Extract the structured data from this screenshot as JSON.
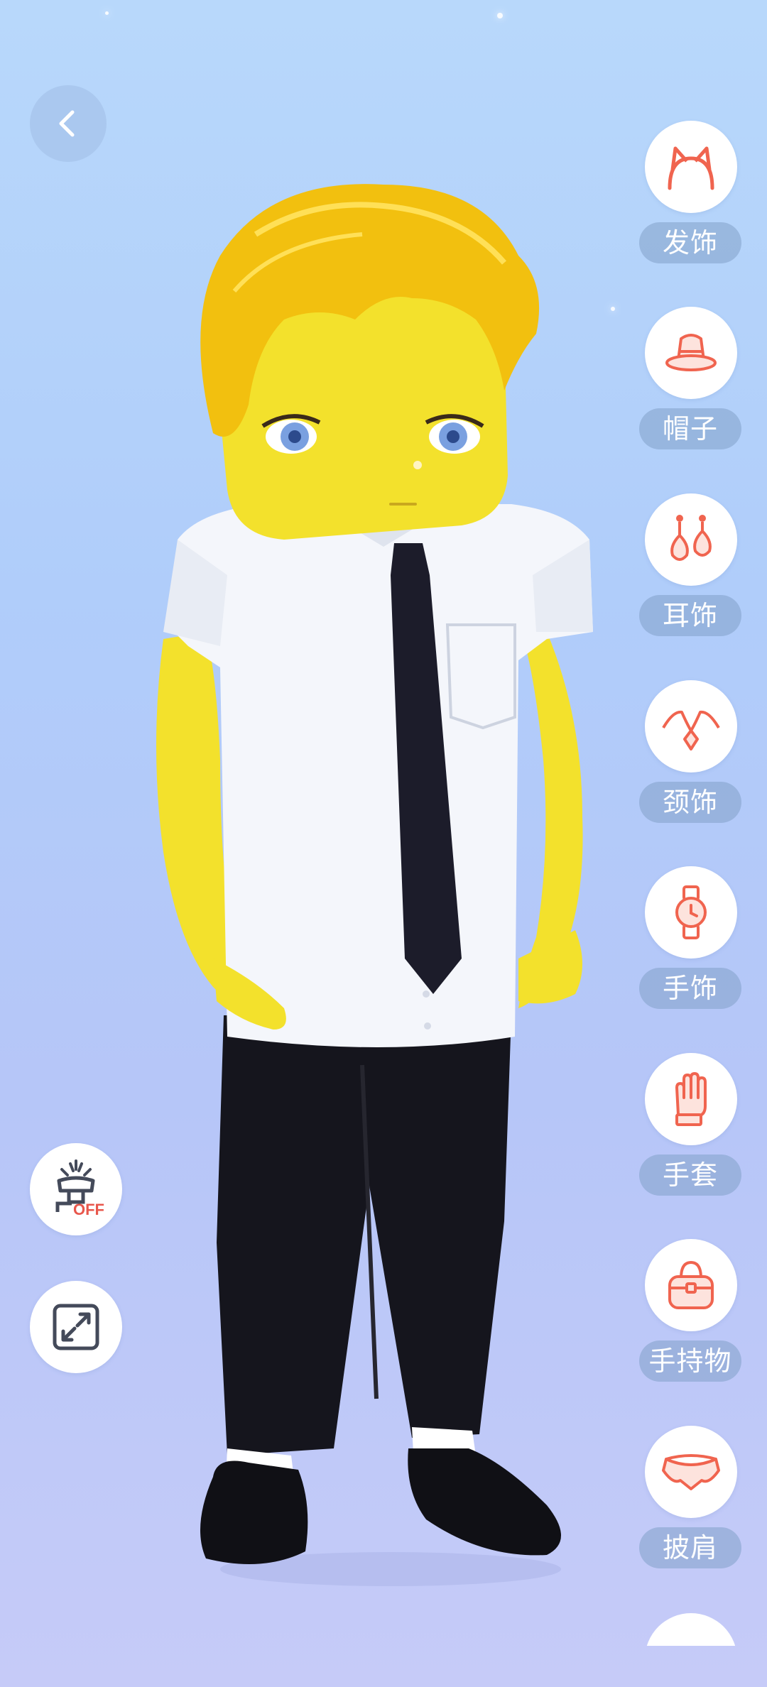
{
  "nav": {
    "back_icon": "chevron-left-icon"
  },
  "colors": {
    "accent": "#f0644f",
    "label_bg": "#8ca4c8",
    "bg_top": "#b8d8fb",
    "bg_bottom": "#c6cbf8"
  },
  "categories": [
    {
      "label": "发饰",
      "icon": "cat-ear-headband-icon"
    },
    {
      "label": "帽子",
      "icon": "bucket-hat-icon"
    },
    {
      "label": "耳饰",
      "icon": "earrings-icon"
    },
    {
      "label": "颈饰",
      "icon": "necklace-icon"
    },
    {
      "label": "手饰",
      "icon": "watch-icon"
    },
    {
      "label": "手套",
      "icon": "glove-icon"
    },
    {
      "label": "手持物",
      "icon": "handbag-icon"
    },
    {
      "label": "披肩",
      "icon": "shawl-icon"
    }
  ],
  "controls": {
    "light_toggle_icon": "lamp-off-icon",
    "light_toggle_text": "OFF",
    "fullscreen_icon": "expand-icon"
  }
}
